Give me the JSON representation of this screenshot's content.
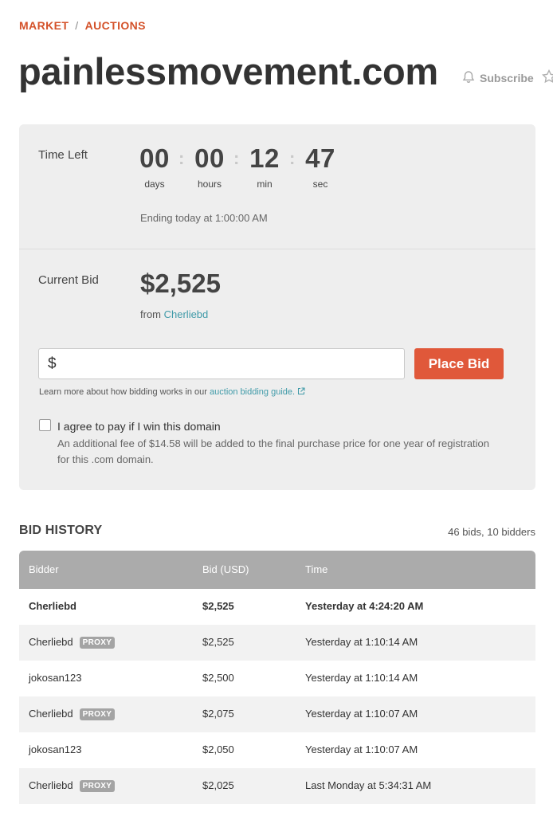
{
  "breadcrumb": {
    "items": [
      "MARKET",
      "AUCTIONS"
    ],
    "separator": "/"
  },
  "domain": "painlessmovement.com",
  "subscribe_label": "Subscribe",
  "auction": {
    "time_left_label": "Time Left",
    "countdown": {
      "days": "00",
      "hours": "00",
      "min": "12",
      "sec": "47",
      "units": {
        "days": "days",
        "hours": "hours",
        "min": "min",
        "sec": "sec"
      }
    },
    "ending_text": "Ending today at 1:00:00 AM",
    "current_bid_label": "Current Bid",
    "current_bid": "$2,525",
    "from_prefix": "from",
    "from_user": "Cherliebd",
    "input_prefix": "$",
    "input_value": "",
    "place_bid_label": "Place Bid",
    "learn_text": "Learn more about how bidding works in our",
    "learn_link": "auction bidding guide.",
    "agree_label": "I agree to pay if I win this domain",
    "agree_checked": false,
    "fee_text": "An additional fee of $14.58 will be added to the final purchase price for one year of registration for this .com domain."
  },
  "bid_history": {
    "title": "BID HISTORY",
    "count": "46 bids, 10 bidders",
    "columns": [
      "Bidder",
      "Bid (USD)",
      "Time"
    ],
    "proxy_label": "PROXY",
    "rows": [
      {
        "bidder": "Cherliebd",
        "proxy": false,
        "bid": "$2,525",
        "time": "Yesterday at 4:24:20 AM",
        "bold": true
      },
      {
        "bidder": "Cherliebd",
        "proxy": true,
        "bid": "$2,525",
        "time": "Yesterday at 1:10:14 AM",
        "bold": false
      },
      {
        "bidder": "jokosan123",
        "proxy": false,
        "bid": "$2,500",
        "time": "Yesterday at 1:10:14 AM",
        "bold": false
      },
      {
        "bidder": "Cherliebd",
        "proxy": true,
        "bid": "$2,075",
        "time": "Yesterday at 1:10:07 AM",
        "bold": false
      },
      {
        "bidder": "jokosan123",
        "proxy": false,
        "bid": "$2,050",
        "time": "Yesterday at 1:10:07 AM",
        "bold": false
      },
      {
        "bidder": "Cherliebd",
        "proxy": true,
        "bid": "$2,025",
        "time": "Last Monday at 5:34:31 AM",
        "bold": false
      }
    ]
  },
  "colors": {
    "accent": "#d4522a",
    "button": "#e0583a",
    "link": "#3f9aa8",
    "panel": "#eeeeee",
    "table_header": "#ababab"
  },
  "icons": [
    "bell-icon",
    "star-icon",
    "external-link-icon"
  ]
}
